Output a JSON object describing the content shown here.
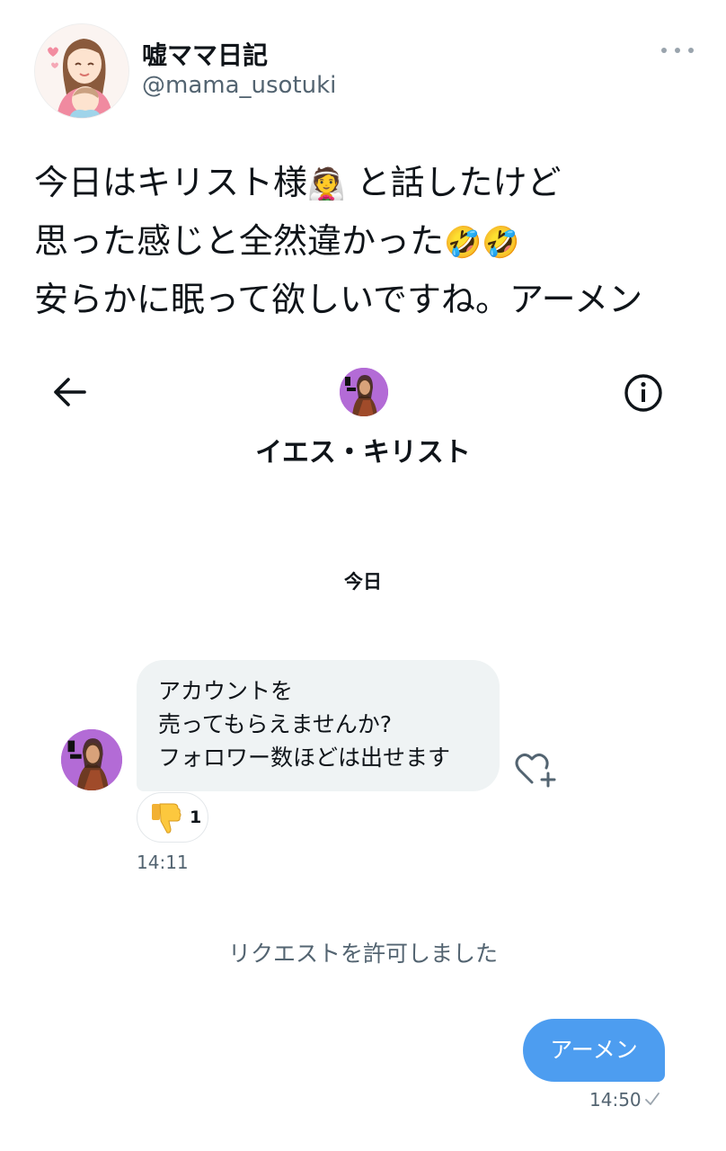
{
  "tweet": {
    "display_name": "嘘ママ日記",
    "handle": "@mama_usotuki",
    "text_lines": [
      {
        "before": "今日はキリスト様",
        "emoji": "👰",
        "after": " と話したけど"
      },
      {
        "before": "思った感じと全然違かった",
        "emoji": "🤣🤣",
        "after": ""
      },
      {
        "before": "安らかに眠って欲しいですね。アーメン",
        "emoji": "",
        "after": ""
      }
    ],
    "icons": {
      "more": "more-horizontal-icon",
      "avatar": "user-avatar"
    }
  },
  "dm": {
    "contact_name": "イエス・キリスト",
    "date_divider": "今日",
    "icons": {
      "back": "back-arrow-icon",
      "info": "info-icon",
      "heart_add": "heart-plus-icon",
      "reaction": "thumbs-down-icon",
      "read": "check-icon"
    },
    "incoming_message": {
      "lines": [
        "アカウントを",
        "売ってもらえませんか?",
        "フォロワー数ほどは出せます"
      ],
      "reaction_count": "1",
      "time": "14:11"
    },
    "system_message": "リクエストを許可しました",
    "outgoing_message": {
      "text": "アーメン",
      "time": "14:50"
    },
    "colors": {
      "outgoing_bubble": "#4d9df0",
      "incoming_bubble": "#eff3f4",
      "secondary_text": "#536471",
      "avatar_bg": "#b36bd6"
    }
  }
}
